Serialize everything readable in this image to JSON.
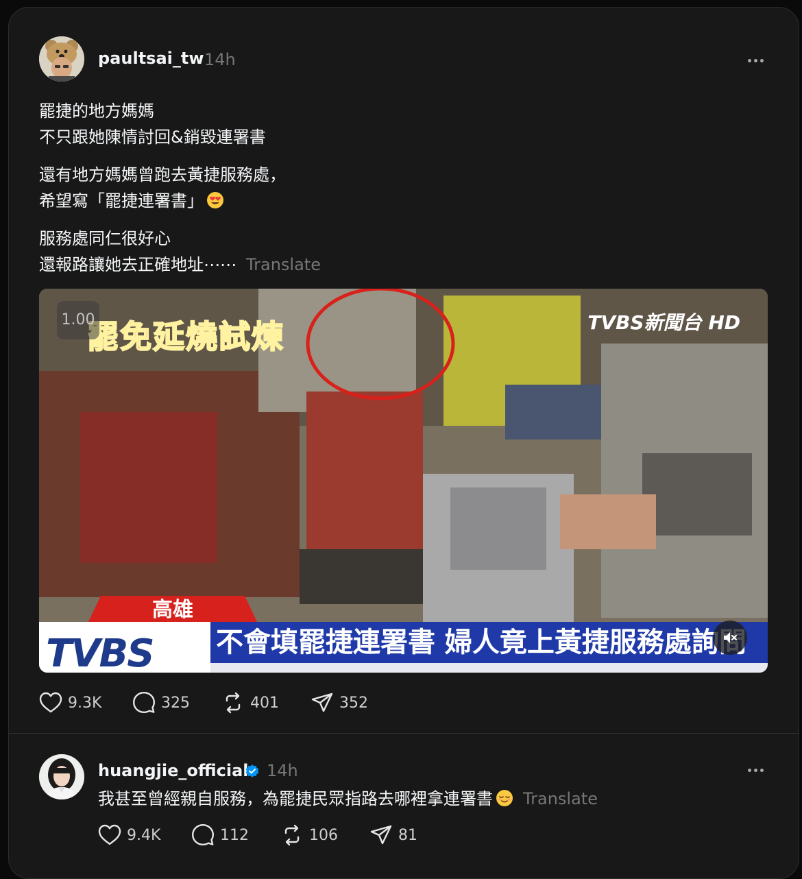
{
  "posts": [
    {
      "username": "paultsai_tw",
      "timestamp": "14h",
      "verified": false,
      "avatar_icon": "bear-hat-avatar-icon",
      "paragraphs": [
        [
          "罷捷的地方媽媽",
          "不只跟她陳情討回&銷毀連署書"
        ],
        [
          "還有地方媽媽曾跑去黃捷服務處，",
          "希望寫「罷捷連署書」"
        ],
        [
          "服務處同仁很好心",
          "還報路讓她去正確地址⋯⋯"
        ]
      ],
      "emoji_icon": "heart-eyes-emoji-icon",
      "translate_label": "Translate",
      "video": {
        "speed": "1.00",
        "banner_title": "罷免延燒試煉",
        "channel_logo": "TVBS新聞台 HD",
        "location": "高雄",
        "logo_text": "TVBS",
        "headline": "不會填罷捷連署書 婦人竟上黃捷服務處詢問",
        "mute_icon": "muted-speaker-icon"
      },
      "stats": {
        "likes": "9.3K",
        "comments": "325",
        "reposts": "401",
        "shares": "352"
      }
    },
    {
      "username": "huangjie_official",
      "timestamp": "14h",
      "verified": true,
      "avatar_icon": "woman-portrait-avatar-icon",
      "text": "我甚至曾經親自服務，為罷捷民眾指路去哪裡拿連署書",
      "emoji_icon": "relieved-face-emoji-icon",
      "translate_label": "Translate",
      "stats": {
        "likes": "9.4K",
        "comments": "112",
        "reposts": "106",
        "shares": "81"
      }
    }
  ],
  "colors": {
    "background": "#0a0a0a",
    "card": "#181818",
    "text_primary": "#f3f5f7",
    "text_secondary": "#777777",
    "verified_blue": "#0095f6"
  }
}
